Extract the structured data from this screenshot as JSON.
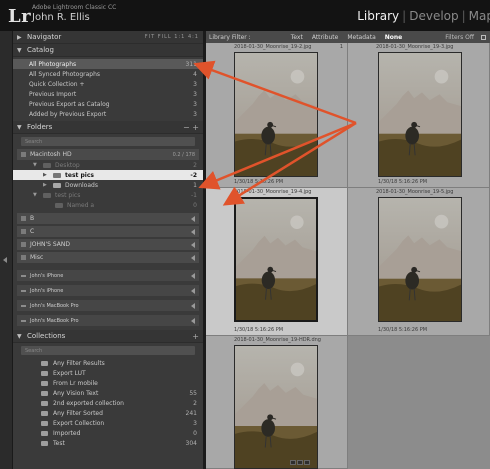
{
  "app": {
    "logo": "Lr",
    "product": "Adobe Lightroom Classic CC",
    "user": "John R. Ellis",
    "modules": [
      "Library",
      "Develop",
      "Map"
    ],
    "active_module": "Library"
  },
  "navigator": {
    "title": "Navigator",
    "zoom_options": "FIT   FILL   1:1   4:1"
  },
  "catalog": {
    "title": "Catalog",
    "items": [
      {
        "label": "All Photographs",
        "count": "311"
      },
      {
        "label": "All Synced Photographs",
        "count": "4"
      },
      {
        "label": "Quick Collection +",
        "count": "3"
      },
      {
        "label": "Previous Import",
        "count": "3"
      },
      {
        "label": "Previous Export as Catalog",
        "count": "3"
      },
      {
        "label": "Added by Previous Export",
        "count": "3"
      }
    ]
  },
  "folders": {
    "title": "Folders",
    "controls": "− +",
    "search_placeholder": "Search",
    "volume": {
      "label": "Macintosh HD",
      "info": "0.2 / 178"
    },
    "tree": [
      {
        "label": "Desktop",
        "count": "2",
        "dim": true
      },
      {
        "label": "test pics",
        "count": "-2",
        "dim": false,
        "selected": true
      },
      {
        "label": "Downloads",
        "count": "1",
        "dim": false
      },
      {
        "label": "test pics",
        "count": "-1",
        "dim": true
      },
      {
        "label": "Named a",
        "count": "0",
        "dim": true
      }
    ],
    "drives": [
      "B",
      "C",
      "JOHN'S SAND",
      "Misc"
    ]
  },
  "devices": [
    "John's iPhone",
    "John's iPhone",
    "John's MacBook Pro",
    "John's MacBook Pro"
  ],
  "collections": {
    "title": "Collections",
    "search_placeholder": "Search",
    "items": [
      {
        "label": "Any Filter Results",
        "count": ""
      },
      {
        "label": "Export LUT",
        "count": ""
      },
      {
        "label": "From Lr mobile",
        "count": ""
      },
      {
        "label": "Any Vision Text",
        "count": "55"
      },
      {
        "label": "2nd exported collection",
        "count": "2"
      },
      {
        "label": "Any Filter Sorted",
        "count": "241"
      },
      {
        "label": "Export Collection",
        "count": "3"
      },
      {
        "label": "Imported",
        "count": "0"
      },
      {
        "label": "Test",
        "count": "304"
      }
    ]
  },
  "filter_bar": {
    "label": "Library Filter :",
    "buttons": [
      "Text",
      "Attribute",
      "Metadata",
      "None"
    ],
    "active": "None",
    "status": "Filters Off"
  },
  "grid": {
    "cells": [
      {
        "filename": "2018-01-30_Moonrise_19-2.jpg",
        "date": "1/30/18 5:16:26 PM",
        "index": "1"
      },
      {
        "filename": "2018-01-30_Moonrise_19-3.jpg",
        "date": "1/30/18 5:16:26 PM",
        "index": ""
      },
      {
        "filename": "2018-01-30_Moonrise_19-4.jpg",
        "date": "1/30/18 5:16:26 PM",
        "index": ""
      },
      {
        "filename": "2018-01-30_Moonrise_19-5.jpg",
        "date": "1/30/18 5:16:26 PM",
        "index": ""
      },
      {
        "filename": "2018-01-30_Moonrise_19-HDR.dng",
        "date": "",
        "index": ""
      }
    ]
  },
  "colors": {
    "accent_arrow": "#e0532b",
    "panel_bg": "#3a3a3a",
    "grid_bg": "#8c8c8c"
  }
}
